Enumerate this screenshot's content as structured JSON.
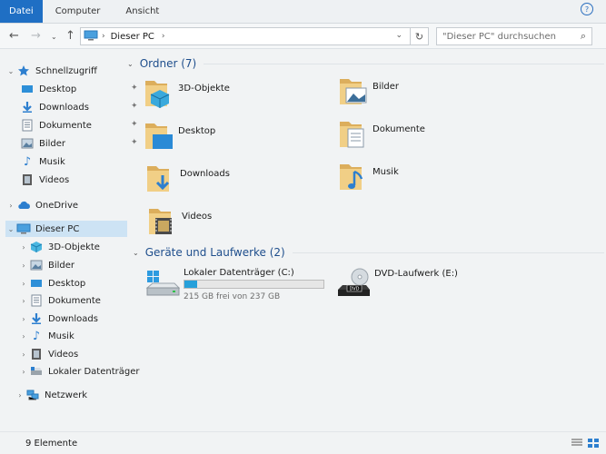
{
  "ribbon": {
    "tabs": [
      {
        "label": "Datei",
        "active": true
      },
      {
        "label": "Computer"
      },
      {
        "label": "Ansicht"
      }
    ]
  },
  "address": {
    "crumb": "Dieser PC",
    "search_placeholder": "\"Dieser PC\" durchsuchen"
  },
  "sidebar": {
    "quick_access": "Schnellzugriff",
    "quick_items": [
      "Desktop",
      "Downloads",
      "Dokumente",
      "Bilder",
      "Musik",
      "Videos"
    ],
    "onedrive": "OneDrive",
    "this_pc": "Dieser PC",
    "pc_items": [
      "3D-Objekte",
      "Bilder",
      "Desktop",
      "Dokumente",
      "Downloads",
      "Musik",
      "Videos",
      "Lokaler Datenträger"
    ],
    "network": "Netzwerk"
  },
  "main": {
    "folders_header": "Ordner (7)",
    "folders": [
      {
        "label": "3D-Objekte",
        "icon": "3d-objects-icon"
      },
      {
        "label": "Bilder",
        "icon": "pictures-icon"
      },
      {
        "label": "Desktop",
        "icon": "desktop-icon"
      },
      {
        "label": "Dokumente",
        "icon": "documents-icon"
      },
      {
        "label": "Downloads",
        "icon": "downloads-icon"
      },
      {
        "label": "Musik",
        "icon": "music-icon"
      },
      {
        "label": "Videos",
        "icon": "videos-icon"
      }
    ],
    "drives_header": "Geräte und Laufwerke (2)",
    "drives": [
      {
        "name": "Lokaler Datenträger (C:)",
        "size": "215 GB frei von 237 GB",
        "used_fraction": 0.093
      },
      {
        "name": "DVD-Laufwerk (E:)"
      }
    ]
  },
  "status": {
    "count": "9 Elemente"
  },
  "colors": {
    "accent": "#1f6fc4",
    "folder": "#e8c57c",
    "selection": "#cde3f4",
    "progress": "#26a0da"
  }
}
